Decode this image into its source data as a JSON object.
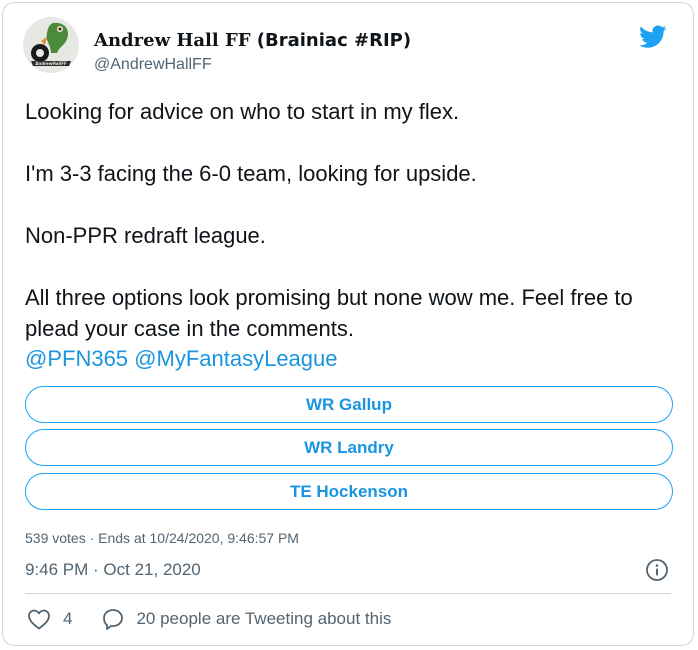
{
  "user": {
    "display_name": "Andrew Hall FF",
    "display_tag": "(Brainiac #RIP)",
    "handle": "@AndrewHallFF",
    "avatar_text": "AndrewHallFF"
  },
  "tweet": {
    "paragraphs": [
      "Looking for advice on who to start in my flex.",
      "I'm 3-3 facing the 6-0 team, looking for upside.",
      "Non-PPR redraft league.",
      "All three options look promising but none wow me. Feel free to plead your case in the comments."
    ],
    "mentions": [
      "@PFN365",
      "@MyFantasyLeague"
    ]
  },
  "poll": {
    "options": [
      "WR Gallup",
      "WR Landry",
      "TE Hockenson"
    ],
    "meta": "539 votes · Ends at 10/24/2020, 9:46:57 PM"
  },
  "timestamp": "9:46 PM · Oct 21, 2020",
  "actions": {
    "likes": "4",
    "reply_text": "20 people are Tweeting about this"
  },
  "colors": {
    "accent": "#1da1f2",
    "link": "#1b95e0",
    "muted": "#536471"
  },
  "icons": [
    "twitter-bird-icon",
    "info-icon",
    "heart-icon",
    "reply-bubble-icon"
  ]
}
